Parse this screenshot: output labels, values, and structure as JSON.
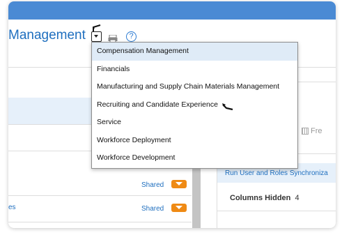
{
  "header": {
    "title": "Management"
  },
  "dropdown": {
    "items": [
      "Compensation Management",
      "Financials",
      "Manufacturing and Supply Chain Materials Management",
      "Recruiting and Candidate Experience",
      "Service",
      "Workforce Deployment",
      "Workforce Development"
    ],
    "selected": "Compensation Management"
  },
  "left_list": {
    "rows": [
      {
        "shared_label": "Shared"
      },
      {
        "shared_label": "Shared",
        "link_text": "es"
      }
    ]
  },
  "right_panel": {
    "freeze_label": "Fre",
    "run_link": "Run User and Roles Synchroniza",
    "columns_hidden_label": "Columns Hidden",
    "columns_hidden_count": "4"
  },
  "colors": {
    "accent": "#4a8ad4",
    "link": "#1f6fbf",
    "shared_button": "#ef8a14",
    "selection": "#dfebf7"
  },
  "icons": [
    "dropdown-toggle-icon",
    "print-icon",
    "help-icon",
    "cursor-icon",
    "freeze-icon",
    "chevron-down-icon"
  ]
}
